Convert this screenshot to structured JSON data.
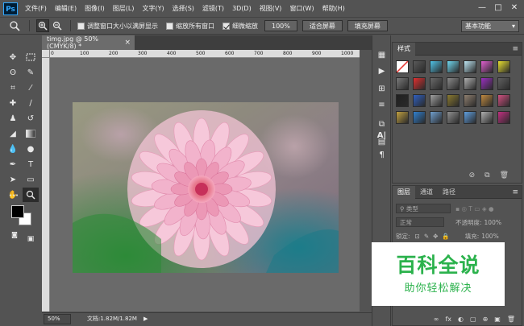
{
  "app": {
    "logo": "Ps"
  },
  "menu": [
    "文件(F)",
    "编辑(E)",
    "图像(I)",
    "图层(L)",
    "文字(Y)",
    "选择(S)",
    "滤镜(T)",
    "3D(D)",
    "视图(V)",
    "窗口(W)",
    "帮助(H)"
  ],
  "window_controls": {
    "minimize": "—",
    "maximize": "□",
    "close": "✕"
  },
  "options": {
    "resize_windows": "调整窗口大小以满屏显示",
    "zoom_all": "缩放所有窗口",
    "scrubby_zoom": "细微缩放",
    "zoom_100": "100%",
    "fit_screen": "适合屏幕",
    "fill_screen": "填充屏幕",
    "workspace": "基本功能",
    "resize_checked": false,
    "zoom_all_checked": false,
    "scrubby_checked": true
  },
  "document": {
    "tab_title": "timg.jpg @ 50%(CMYK/8) *",
    "close_glyph": "×",
    "ruler_ticks": [
      "0",
      "100",
      "200",
      "300",
      "400",
      "500",
      "600",
      "700",
      "800",
      "900",
      "1000"
    ]
  },
  "status": {
    "zoom": "50%",
    "doc_size": "文档:1.82M/1.82M",
    "arrow": "▶"
  },
  "styles_panel": {
    "tab": "样式",
    "swatch_colors": [
      "#ffffff",
      "#5a5a5a",
      "#4fc3e8",
      "#70d8f0",
      "#bfe8f5",
      "#e05fd0",
      "#e8e030",
      "#7a7a7a",
      "#e03030",
      "#6a6a6a",
      "#8a8a8a",
      "#b0b0b0",
      "#9a30c0",
      "#606060",
      "#202020",
      "#3060c0",
      "#a0a0a0",
      "#8a7a30",
      "#908070",
      "#c08a40",
      "#d05080",
      "#c0a040",
      "#3080d0",
      "#70a0d0",
      "#909090",
      "#60a0e0",
      "#b0b0b0",
      "#c03080"
    ]
  },
  "layers_panel": {
    "tabs": [
      "图层",
      "通道",
      "路径"
    ],
    "kind_filter": "类型",
    "blend_mode": "正常",
    "opacity_label": "不透明度:",
    "opacity_value": "100%",
    "lock_label": "锁定:",
    "fill_label": "填充:",
    "fill_value": "100%",
    "footer_icons": [
      "∞",
      "fx",
      "◐",
      "▢",
      "⊕",
      "▣",
      "🗑"
    ]
  },
  "watermark": {
    "title": "百科全说",
    "subtitle": "助你轻松解决"
  }
}
